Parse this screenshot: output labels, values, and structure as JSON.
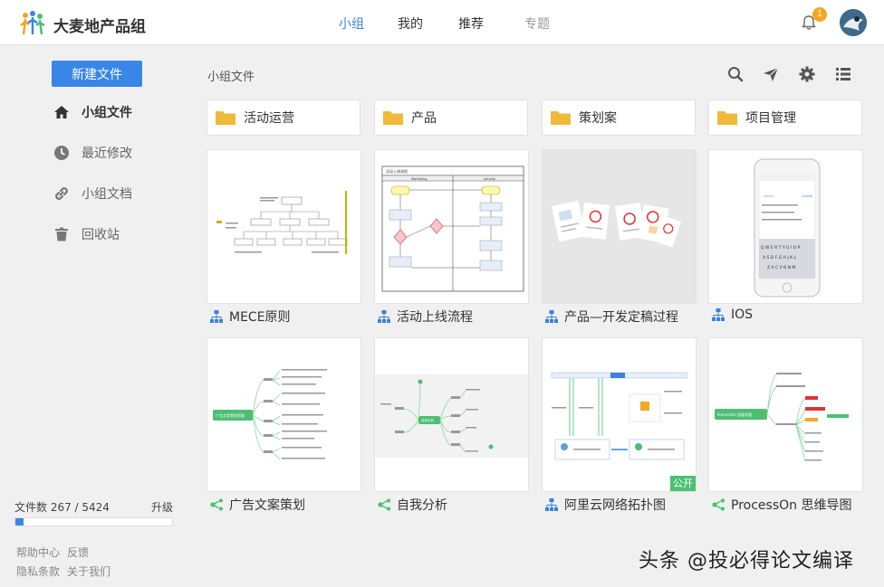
{
  "header": {
    "brand": "大麦地产品组",
    "nav": [
      {
        "label": "小组",
        "active": true
      },
      {
        "label": "我的",
        "active": false
      },
      {
        "label": "推荐",
        "active": false
      },
      {
        "label": "专题",
        "active": false
      }
    ],
    "notification_count": "1",
    "icons": [
      "logo-icon",
      "bell-icon",
      "avatar"
    ]
  },
  "sidebar": {
    "new_button": "新建文件",
    "items": [
      {
        "label": "小组文件",
        "icon": "home-icon",
        "active": true
      },
      {
        "label": "最近修改",
        "icon": "clock-icon",
        "active": false
      },
      {
        "label": "小组文档",
        "icon": "link-icon",
        "active": false
      },
      {
        "label": "回收站",
        "icon": "trash-icon",
        "active": false
      }
    ],
    "quota": {
      "label": "文件数 267 / 5424",
      "upgrade": "升级",
      "used": 267,
      "total": 5424
    },
    "footer": [
      "帮助中心",
      "反馈",
      "隐私条款",
      "关于我们"
    ]
  },
  "main": {
    "breadcrumb": "小组文件",
    "toolbar_icons": [
      "search-icon",
      "send-icon",
      "gear-icon",
      "list-icon"
    ],
    "folders": [
      "活动运营",
      "产品",
      "策划案",
      "项目管理"
    ],
    "files": [
      {
        "name": "MECE原则",
        "type": "flowchart"
      },
      {
        "name": "活动上线流程",
        "type": "flowchart"
      },
      {
        "name": "产品—开发定稿过程",
        "type": "flowchart"
      },
      {
        "name": "IOS",
        "type": "flowchart"
      },
      {
        "name": "广告文案策划",
        "type": "mindmap"
      },
      {
        "name": "自我分析",
        "type": "mindmap"
      },
      {
        "name": "阿里云网络拓扑图",
        "type": "flowchart",
        "tag": "公开"
      },
      {
        "name": "ProcessOn 思维导图",
        "type": "mindmap"
      }
    ]
  },
  "thumbnails": {
    "flow_header_left": "Marketing",
    "flow_header_right": "Activity",
    "flow_title": "活动上线流程",
    "ios_search": "search",
    "ios_cancel": "Cancel",
    "ios_keys_row1": "Q W E R T Y U I O P",
    "ios_keys_row2": "A S D F G H J K L",
    "ios_keys_row3": "Z X C V B N M",
    "mindmap_ad_center": "广告文案策划思路",
    "mindmap_self_center": "自我分析",
    "mindmap_po_center": "ProcessOn 思维导图"
  },
  "watermark": "头条 @投必得论文编译"
}
